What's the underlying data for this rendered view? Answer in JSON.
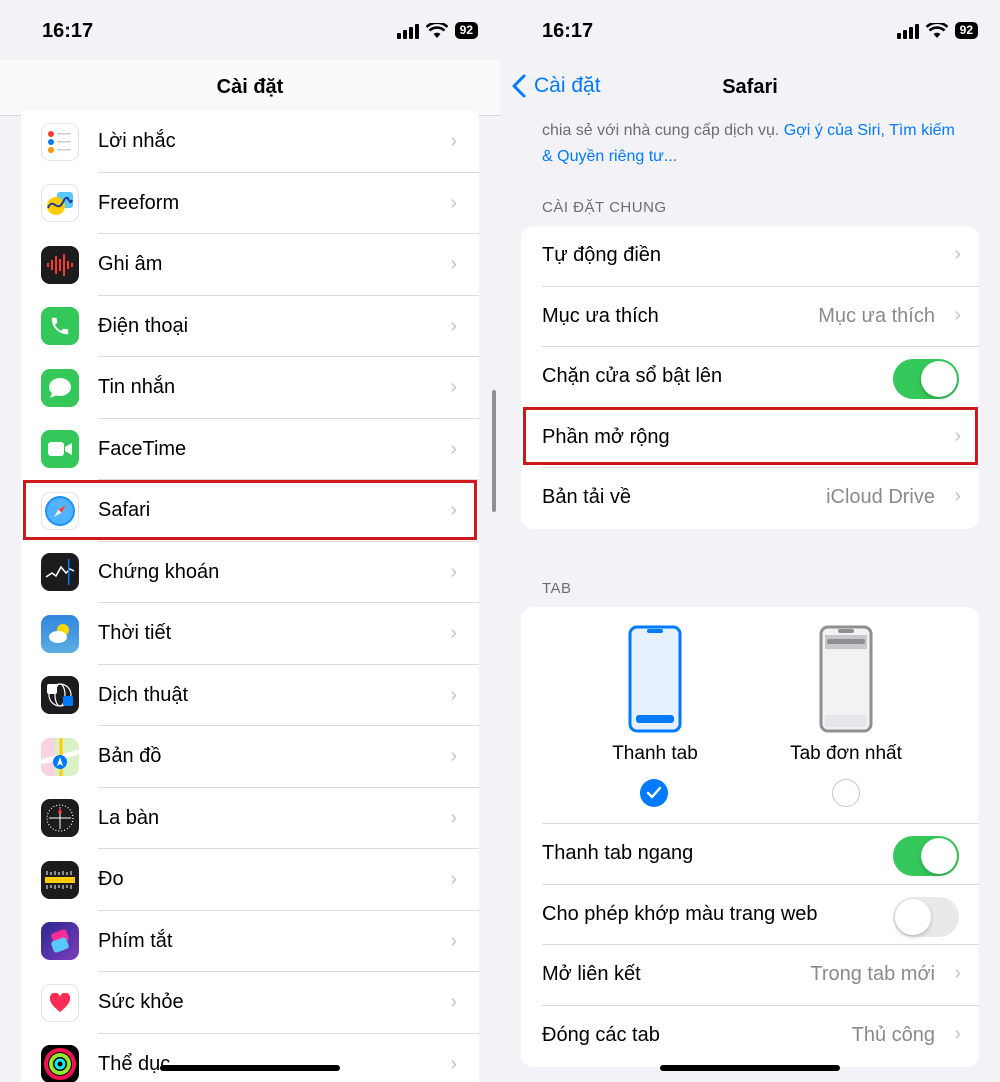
{
  "left": {
    "status": {
      "time": "16:17",
      "battery": "92"
    },
    "nav_title": "Cài đặt",
    "items": [
      {
        "label": "Lời nhắc",
        "icon": "reminders-icon"
      },
      {
        "label": "Freeform",
        "icon": "freeform-icon"
      },
      {
        "label": "Ghi âm",
        "icon": "voice-memos-icon"
      },
      {
        "label": "Điện thoại",
        "icon": "phone-icon"
      },
      {
        "label": "Tin nhắn",
        "icon": "messages-icon"
      },
      {
        "label": "FaceTime",
        "icon": "facetime-icon"
      },
      {
        "label": "Safari",
        "icon": "safari-icon"
      },
      {
        "label": "Chứng khoán",
        "icon": "stocks-icon"
      },
      {
        "label": "Thời tiết",
        "icon": "weather-icon"
      },
      {
        "label": "Dịch thuật",
        "icon": "translate-icon"
      },
      {
        "label": "Bản đồ",
        "icon": "maps-icon"
      },
      {
        "label": "La bàn",
        "icon": "compass-icon"
      },
      {
        "label": "Đo",
        "icon": "measure-icon"
      },
      {
        "label": "Phím tắt",
        "icon": "shortcuts-icon"
      },
      {
        "label": "Sức khỏe",
        "icon": "health-icon"
      },
      {
        "label": "Thể dục",
        "icon": "fitness-icon"
      }
    ]
  },
  "right": {
    "status": {
      "time": "16:17",
      "battery": "92"
    },
    "back_label": "Cài đặt",
    "nav_title": "Safari",
    "footnote_text": "chia sẻ với nhà cung cấp dịch vụ.",
    "footnote_link": "Gợi ý của Siri, Tìm kiếm & Quyền riêng tư...",
    "general_header": "CÀI ĐẶT CHUNG",
    "general": {
      "autofill": "Tự động điền",
      "favorites": "Mục ưa thích",
      "favorites_value": "Mục ưa thích",
      "block_popups": "Chặn cửa sổ bật lên",
      "extensions": "Phần mở rộng",
      "downloads": "Bản tải về",
      "downloads_value": "iCloud Drive"
    },
    "tab_header": "TAB",
    "tabs": {
      "tab_bar": "Thanh tab",
      "single_tab": "Tab đơn nhất",
      "landscape_tab_bar": "Thanh tab ngang",
      "website_tinting": "Cho phép khớp màu trang web",
      "open_links": "Mở liên kết",
      "open_links_value": "Trong tab mới",
      "close_tabs": "Đóng các tab",
      "close_tabs_value": "Thủ công"
    },
    "toggles": {
      "block_popups": true,
      "landscape_tab_bar": true,
      "website_tinting": false
    },
    "accent": "#007aff",
    "toggle_on_color": "#34c759",
    "highlight_color": "#d0191c"
  }
}
